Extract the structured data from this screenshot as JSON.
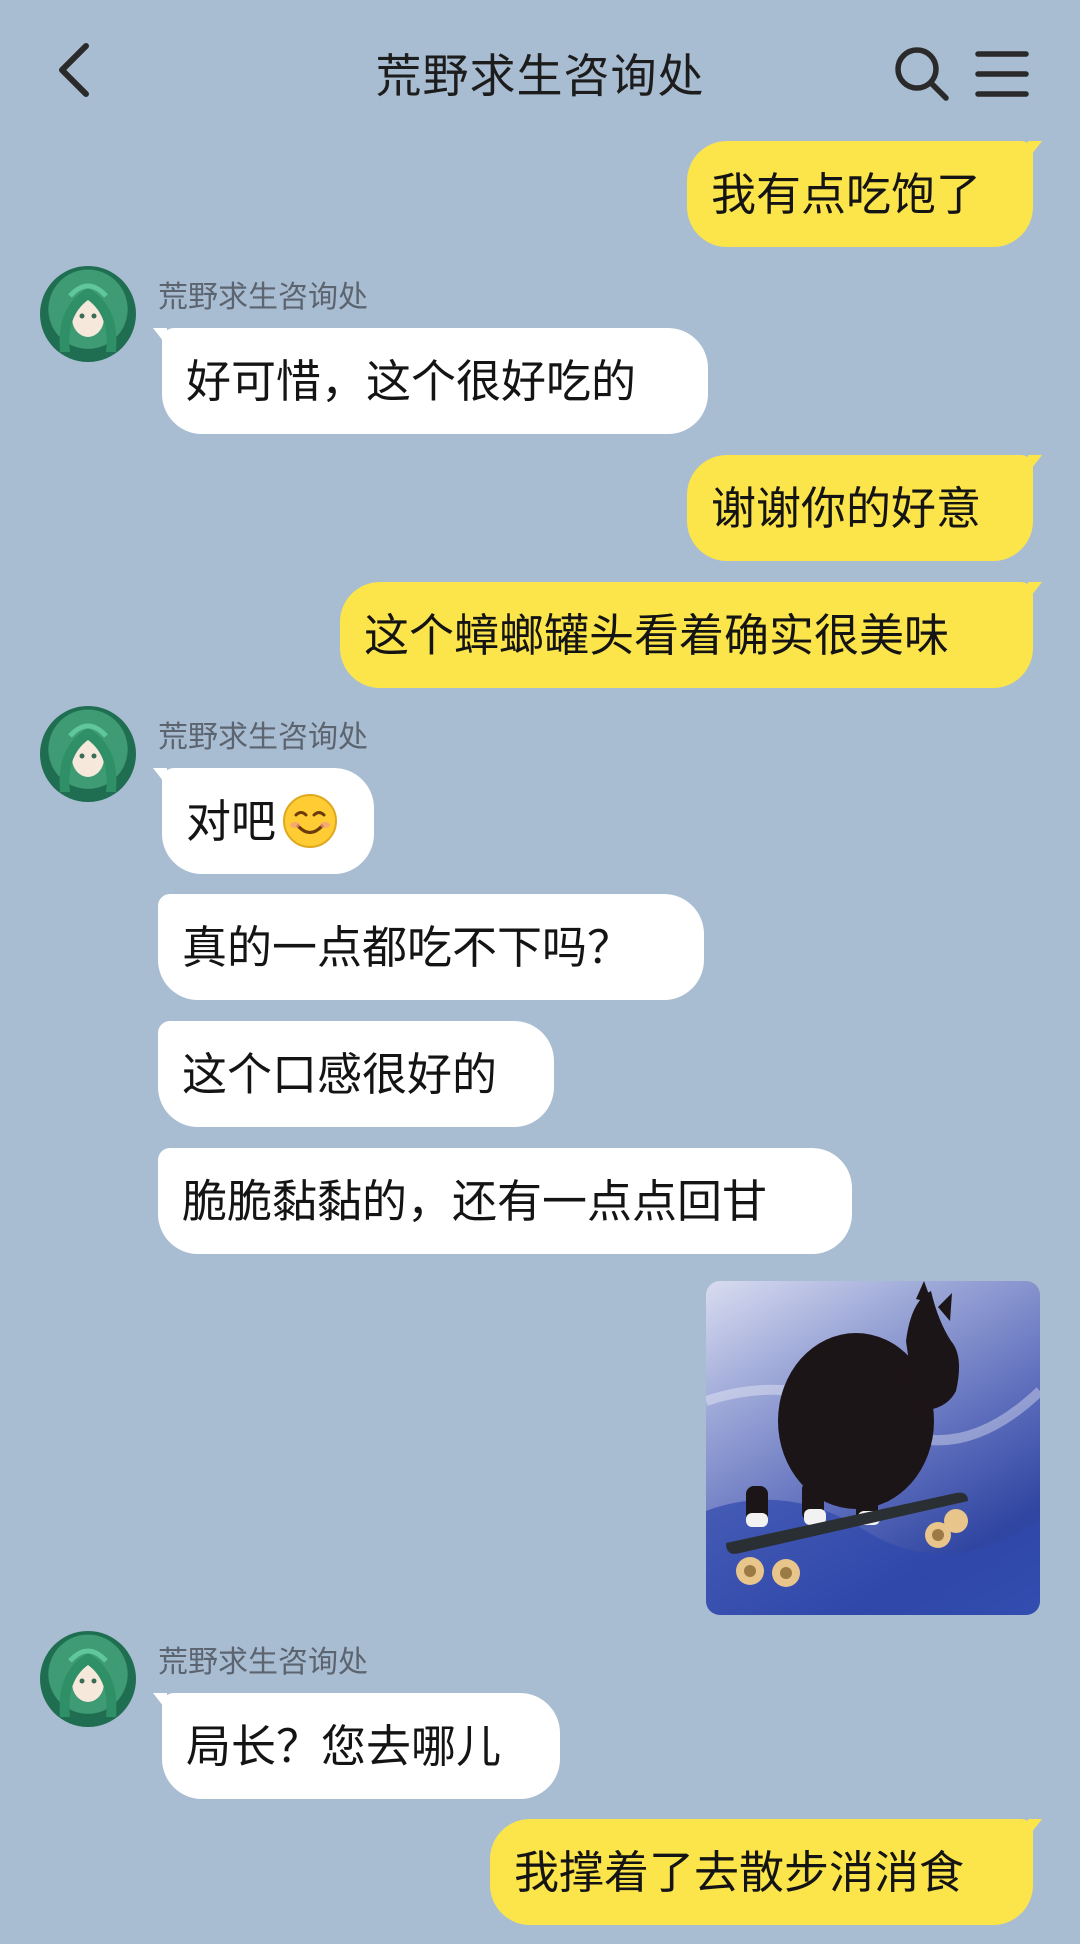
{
  "header": {
    "title": "荒野求生咨询处",
    "back_icon": "chevron-left-icon",
    "search_icon": "search-icon",
    "menu_icon": "menu-icon"
  },
  "messages": [
    {
      "side": "right",
      "text": "我有点吃饱了"
    },
    {
      "side": "left",
      "sender": "荒野求生咨询处",
      "text": "好可惜，这个很好吃的"
    },
    {
      "side": "right",
      "text": "谢谢你的好意"
    },
    {
      "side": "right",
      "text": "这个蟑螂罐头看着确实很美味"
    },
    {
      "side": "left",
      "sender": "荒野求生咨询处",
      "text": "对吧",
      "emoji": "smiling-face-emoji"
    },
    {
      "side": "left",
      "text": "真的一点都吃不下吗？"
    },
    {
      "side": "left",
      "text": "这个口感很好的"
    },
    {
      "side": "left",
      "text": "脆脆黏黏的，还有一点点回甘"
    },
    {
      "side": "right",
      "image": "cat-on-skateboard-sticker"
    },
    {
      "side": "left",
      "sender": "荒野求生咨询处",
      "text": "局长？您去哪儿"
    },
    {
      "side": "right",
      "text": "我撑着了去散步消消食"
    }
  ],
  "colors": {
    "background": "#a9bdd2",
    "outgoing_bubble": "#fce54a",
    "incoming_bubble": "#ffffff",
    "sender_name": "#5c6470"
  }
}
